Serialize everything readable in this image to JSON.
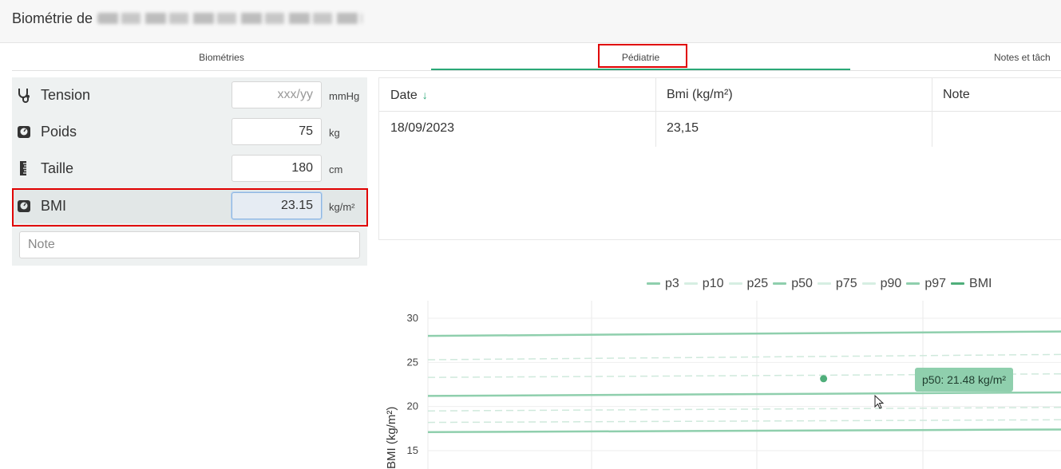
{
  "header": {
    "title": "Biométrie de"
  },
  "tabs": [
    {
      "label": "Biométries"
    },
    {
      "label": "Pédiatrie"
    },
    {
      "label": "Notes et tâch"
    }
  ],
  "biometrics": {
    "tension": {
      "label": "Tension",
      "placeholder": "xxx/yy",
      "unit": "mmHg"
    },
    "poids": {
      "label": "Poids",
      "value": "75",
      "unit": "kg"
    },
    "taille": {
      "label": "Taille",
      "value": "180",
      "unit": "cm"
    },
    "bmi": {
      "label": "BMI",
      "value": "23.15",
      "unit": "kg/m²"
    },
    "note_placeholder": "Note"
  },
  "table": {
    "headers": [
      "Date",
      "Bmi (kg/m²)",
      "Note"
    ],
    "rows": [
      [
        "18/09/2023",
        "23,15",
        ""
      ]
    ]
  },
  "legend": [
    {
      "name": "p3",
      "color": "#8fcfad"
    },
    {
      "name": "p10",
      "color": "#d6eee2"
    },
    {
      "name": "p25",
      "color": "#d6eee2"
    },
    {
      "name": "p50",
      "color": "#8fcfad"
    },
    {
      "name": "p75",
      "color": "#d6eee2"
    },
    {
      "name": "p90",
      "color": "#d6eee2"
    },
    {
      "name": "p97",
      "color": "#8fcfad"
    },
    {
      "name": "BMI",
      "color": "#4fae7a"
    }
  ],
  "tooltip": {
    "text": "p50: 21.48 kg/m²"
  },
  "chart_data": {
    "type": "line",
    "ylabel": "BMI (kg/m²)",
    "yticks": [
      "30",
      "25",
      "20",
      "15"
    ],
    "ylim": [
      13,
      32
    ],
    "xlim": [
      0,
      4
    ],
    "series": [
      {
        "name": "p97",
        "style": "solid",
        "x": [
          0,
          4
        ],
        "y": [
          28.0,
          28.5
        ]
      },
      {
        "name": "p90",
        "style": "dashed",
        "x": [
          0,
          4
        ],
        "y": [
          25.3,
          25.9
        ]
      },
      {
        "name": "p75",
        "style": "dashed",
        "x": [
          0,
          4
        ],
        "y": [
          23.3,
          23.7
        ]
      },
      {
        "name": "p50",
        "style": "solid",
        "x": [
          0,
          4
        ],
        "y": [
          21.2,
          21.6
        ]
      },
      {
        "name": "p25",
        "style": "dashed",
        "x": [
          0,
          4
        ],
        "y": [
          19.5,
          19.9
        ]
      },
      {
        "name": "p10",
        "style": "dashed",
        "x": [
          0,
          4
        ],
        "y": [
          18.2,
          18.5
        ]
      },
      {
        "name": "p3",
        "style": "solid",
        "x": [
          0,
          4
        ],
        "y": [
          17.1,
          17.4
        ]
      },
      {
        "name": "BMI",
        "style": "point",
        "x": [
          2.5
        ],
        "y": [
          23.15
        ]
      }
    ],
    "grid": true
  },
  "icons": {
    "tension": "stethoscope-icon",
    "poids": "scale-icon",
    "taille": "ruler-icon",
    "bmi": "scale-icon",
    "sort": "arrow-down-icon",
    "cursor": "mouse-pointer-icon"
  },
  "colors": {
    "accent": "#2aa877",
    "highlight": "#e00000"
  }
}
